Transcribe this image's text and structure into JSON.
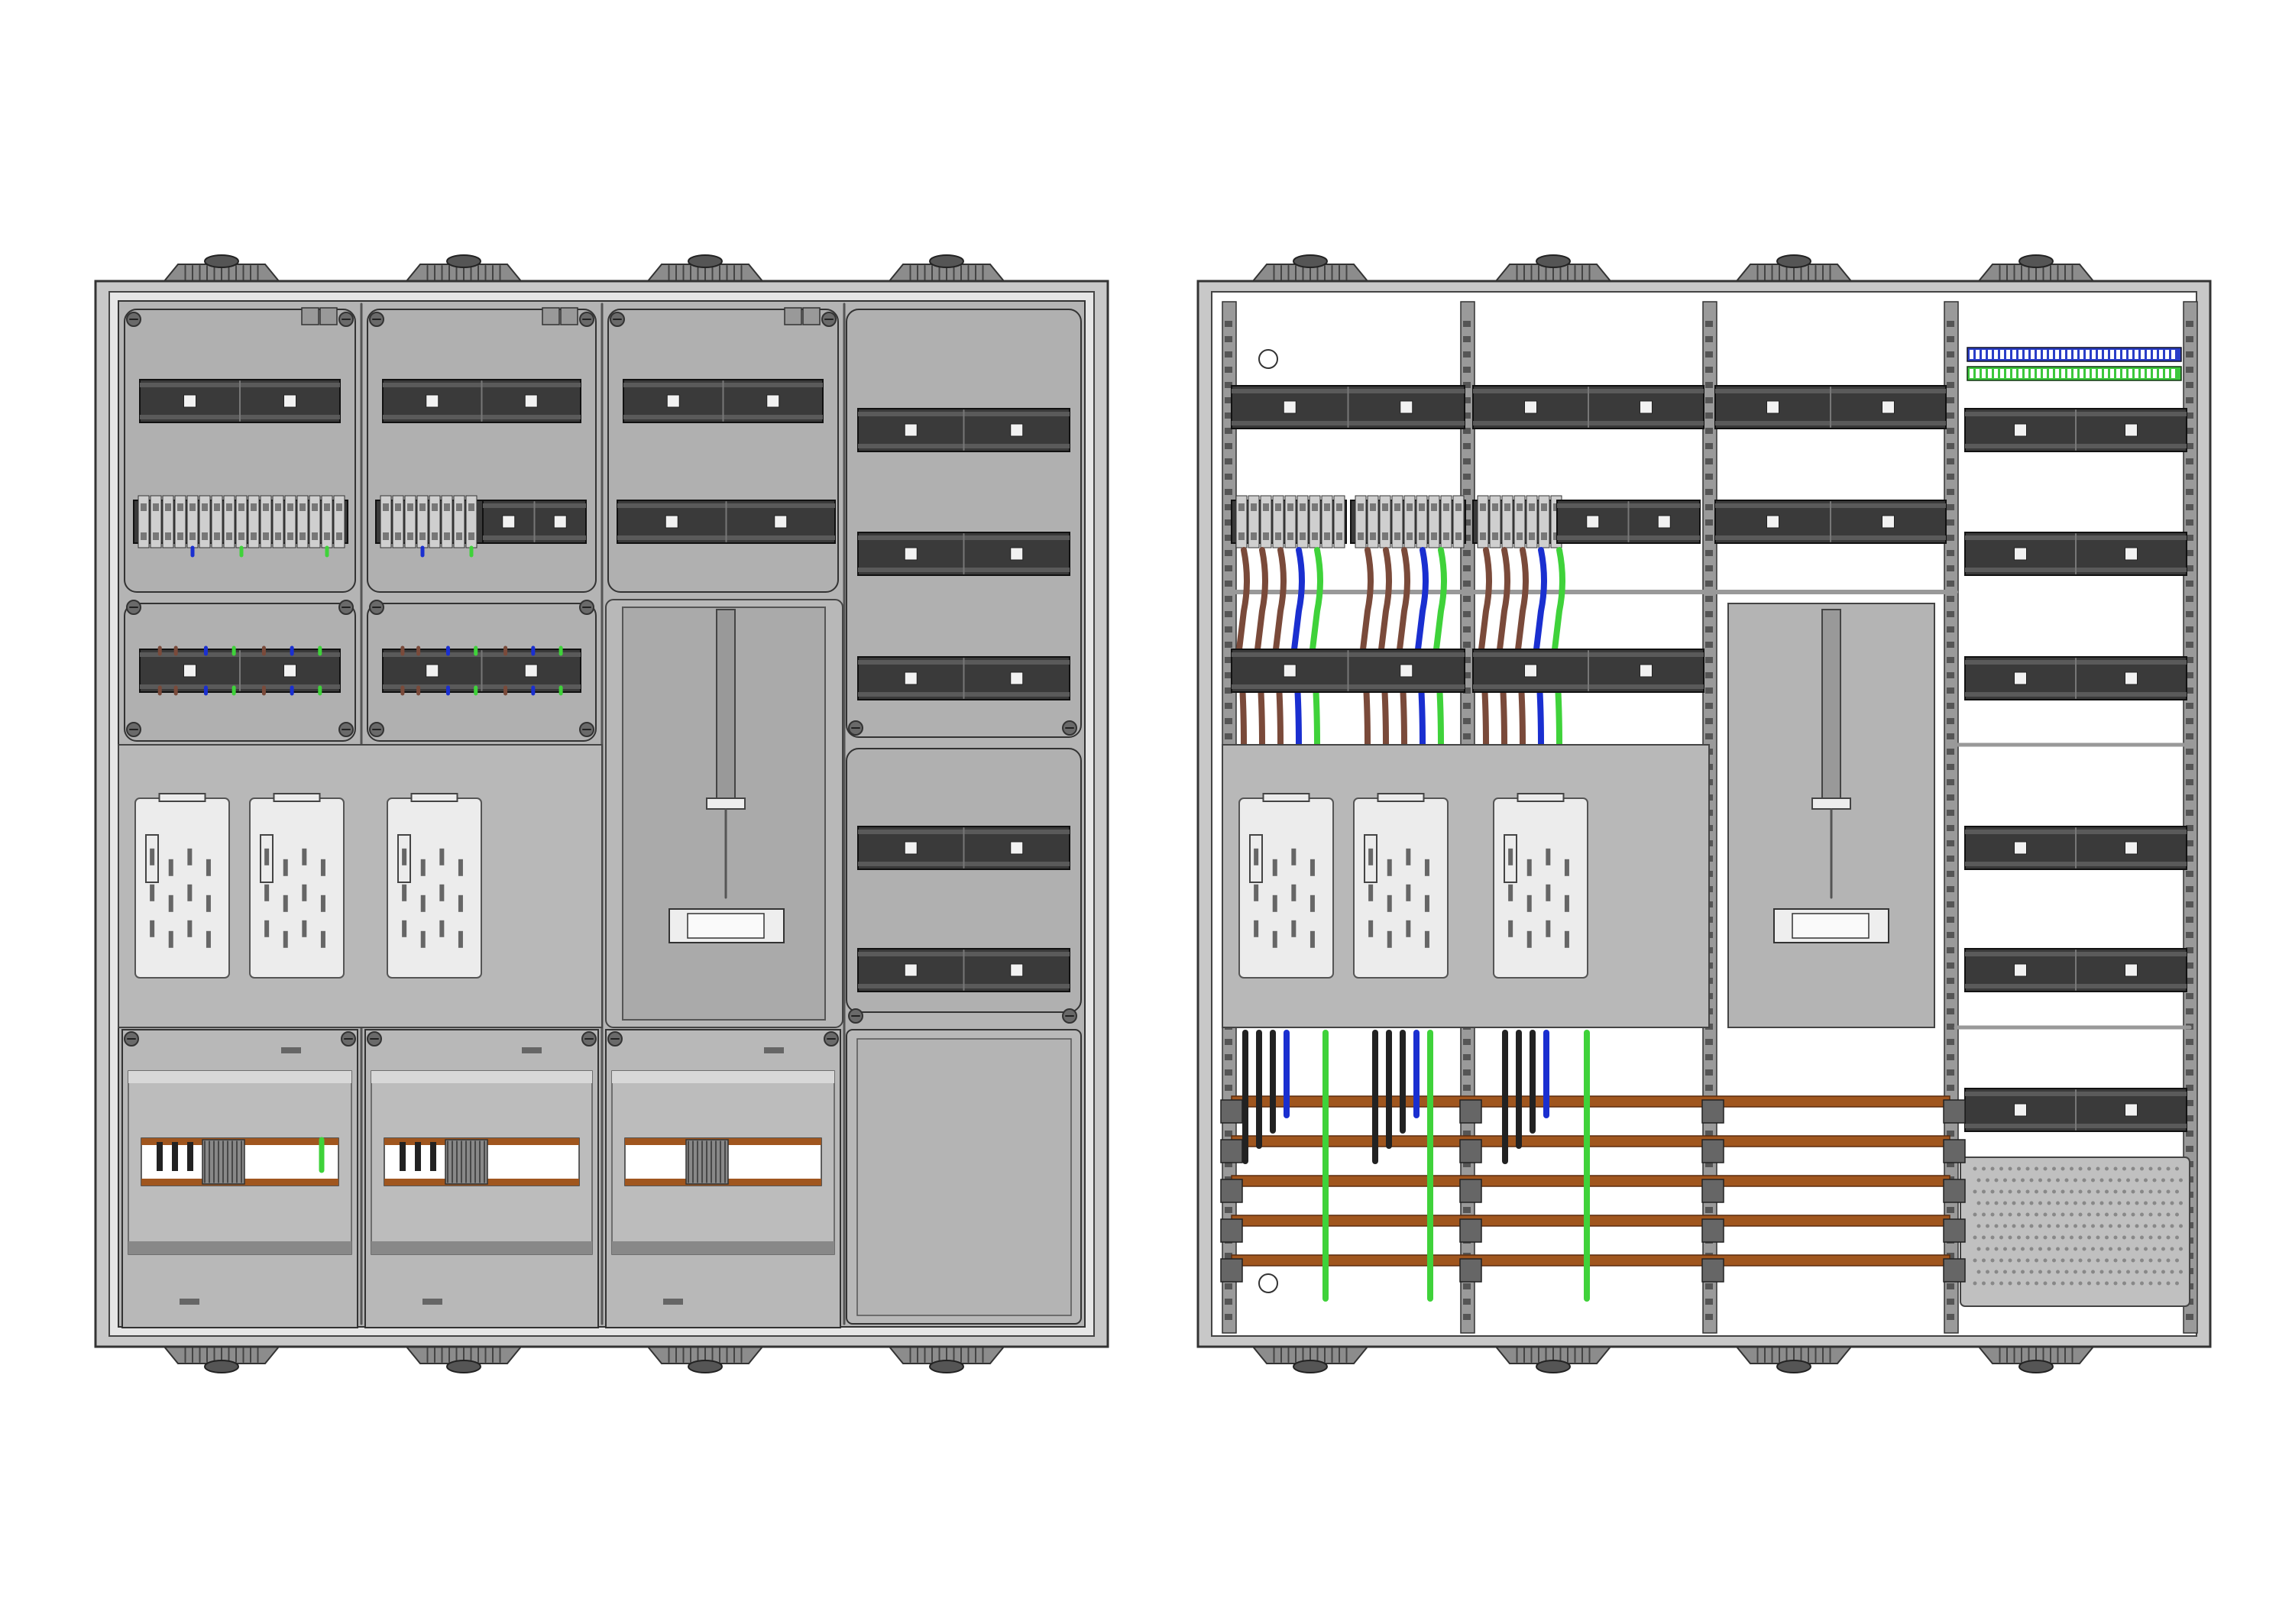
{
  "drawing": {
    "cabinets": [
      {
        "id": "front",
        "view": "closed-covers",
        "fields": [
          {
            "content": [
              "din-rail",
              "terminal-rail",
              "rail-with-wires",
              "meter-panel-2",
              "main-terminal-block"
            ]
          },
          {
            "content": [
              "din-rail",
              "terminal-rail",
              "rail-with-wires",
              "meter-panel-1",
              "main-terminal-block"
            ]
          },
          {
            "content": [
              "din-rail",
              "din-rail",
              "apz-blind-panel",
              "main-terminal-block"
            ]
          },
          {
            "content": [
              "din-rail",
              "din-rail",
              "din-rail",
              "din-rail",
              "din-rail",
              "blank-cover"
            ]
          }
        ]
      },
      {
        "id": "open",
        "view": "open-wired",
        "fields": [
          {
            "content": [
              "din-rail",
              "terminal-rail",
              "wired-rail",
              "meter-panel-2",
              "busbars"
            ]
          },
          {
            "content": [
              "din-rail",
              "terminal-rail",
              "wired-rail",
              "meter-panel-1",
              "busbars"
            ]
          },
          {
            "content": [
              "din-rail",
              "din-rail",
              "apz-blind-panel",
              "busbars"
            ]
          },
          {
            "content": [
              "terminal-block",
              "din-rail",
              "din-rail",
              "din-rail",
              "din-rail",
              "din-rail",
              "din-rail",
              "perforated-plate"
            ]
          }
        ]
      }
    ],
    "colors": {
      "background": "#ffffff",
      "frame": "#c8c8c8",
      "cover": "#b4b4b4",
      "din_rail": "#3a3a3a",
      "busbar": "#a0561e",
      "wire_brown": "#7a4a3a",
      "wire_blue": "#1a2fd0",
      "wire_green": "#3fd23a",
      "wire_black": "#222222",
      "terminal_blue": "#2a3ec8",
      "terminal_green": "#3cc83c"
    }
  }
}
